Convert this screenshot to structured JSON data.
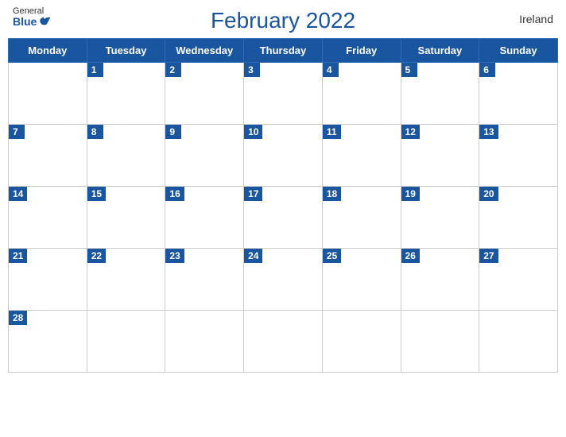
{
  "header": {
    "logo_general": "General",
    "logo_blue": "Blue",
    "title": "February 2022",
    "country": "Ireland"
  },
  "days": [
    "Monday",
    "Tuesday",
    "Wednesday",
    "Thursday",
    "Friday",
    "Saturday",
    "Sunday"
  ],
  "weeks": [
    [
      null,
      1,
      2,
      3,
      4,
      5,
      6
    ],
    [
      7,
      8,
      9,
      10,
      11,
      12,
      13
    ],
    [
      14,
      15,
      16,
      17,
      18,
      19,
      20
    ],
    [
      21,
      22,
      23,
      24,
      25,
      26,
      27
    ],
    [
      28,
      null,
      null,
      null,
      null,
      null,
      null
    ]
  ],
  "colors": {
    "blue": "#1a56a0",
    "white": "#ffffff",
    "border": "#cccccc"
  }
}
